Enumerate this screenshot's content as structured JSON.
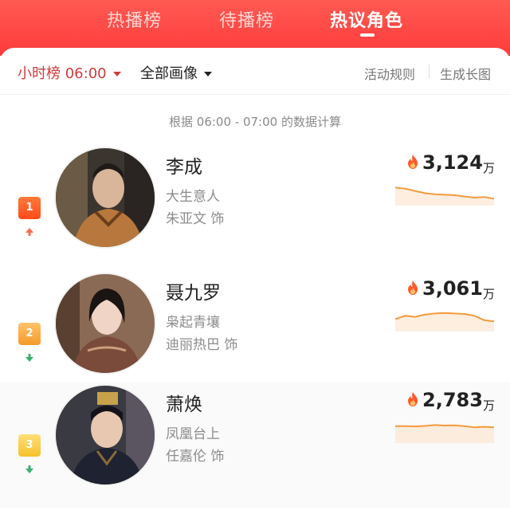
{
  "tabs": [
    {
      "label": "热播榜",
      "active": false
    },
    {
      "label": "待播榜",
      "active": false
    },
    {
      "label": "热议角色",
      "active": true
    }
  ],
  "filters": {
    "time": "小时榜 06:00",
    "genre": "全部画像",
    "rules_link": "活动规则",
    "poster_link": "生成长图"
  },
  "basis_text": "根据 06:00 - 07:00 的数据计算",
  "colors": {
    "header": "#ff3b3b",
    "accent": "#d43a3a",
    "rank1": "#ff4a1a",
    "rank2": "#f59a2a",
    "rank3": "#f6c02a",
    "trend_up": "#ff6b4a",
    "trend_down": "#37b26c",
    "spark": "#f39b3d"
  },
  "list": [
    {
      "rank": "1",
      "trend": "up",
      "name": "李成",
      "drama": "大生意人",
      "actor": "朱亚文 饰",
      "heat": "3,124",
      "unit": "万",
      "sparkline": [
        0.3,
        0.35,
        0.45,
        0.55,
        0.6,
        0.62,
        0.64,
        0.7,
        0.75,
        0.72,
        0.8
      ]
    },
    {
      "rank": "2",
      "trend": "down",
      "name": "聂九罗",
      "drama": "枭起青壤",
      "actor": "迪丽热巴 饰",
      "heat": "3,061",
      "unit": "万",
      "sparkline": [
        0.55,
        0.4,
        0.45,
        0.35,
        0.3,
        0.28,
        0.3,
        0.32,
        0.4,
        0.6,
        0.65
      ]
    },
    {
      "rank": "3",
      "trend": "down",
      "name": "萧焕",
      "drama": "凤凰台上",
      "actor": "任嘉伦 饰",
      "heat": "2,783",
      "unit": "万",
      "sparkline": [
        0.35,
        0.35,
        0.36,
        0.34,
        0.3,
        0.32,
        0.31,
        0.35,
        0.4,
        0.38,
        0.4
      ]
    }
  ],
  "icons": {
    "flame": "flame-icon",
    "up": "arrow-up-icon",
    "down": "arrow-down-icon",
    "caret": "caret-down-icon"
  }
}
